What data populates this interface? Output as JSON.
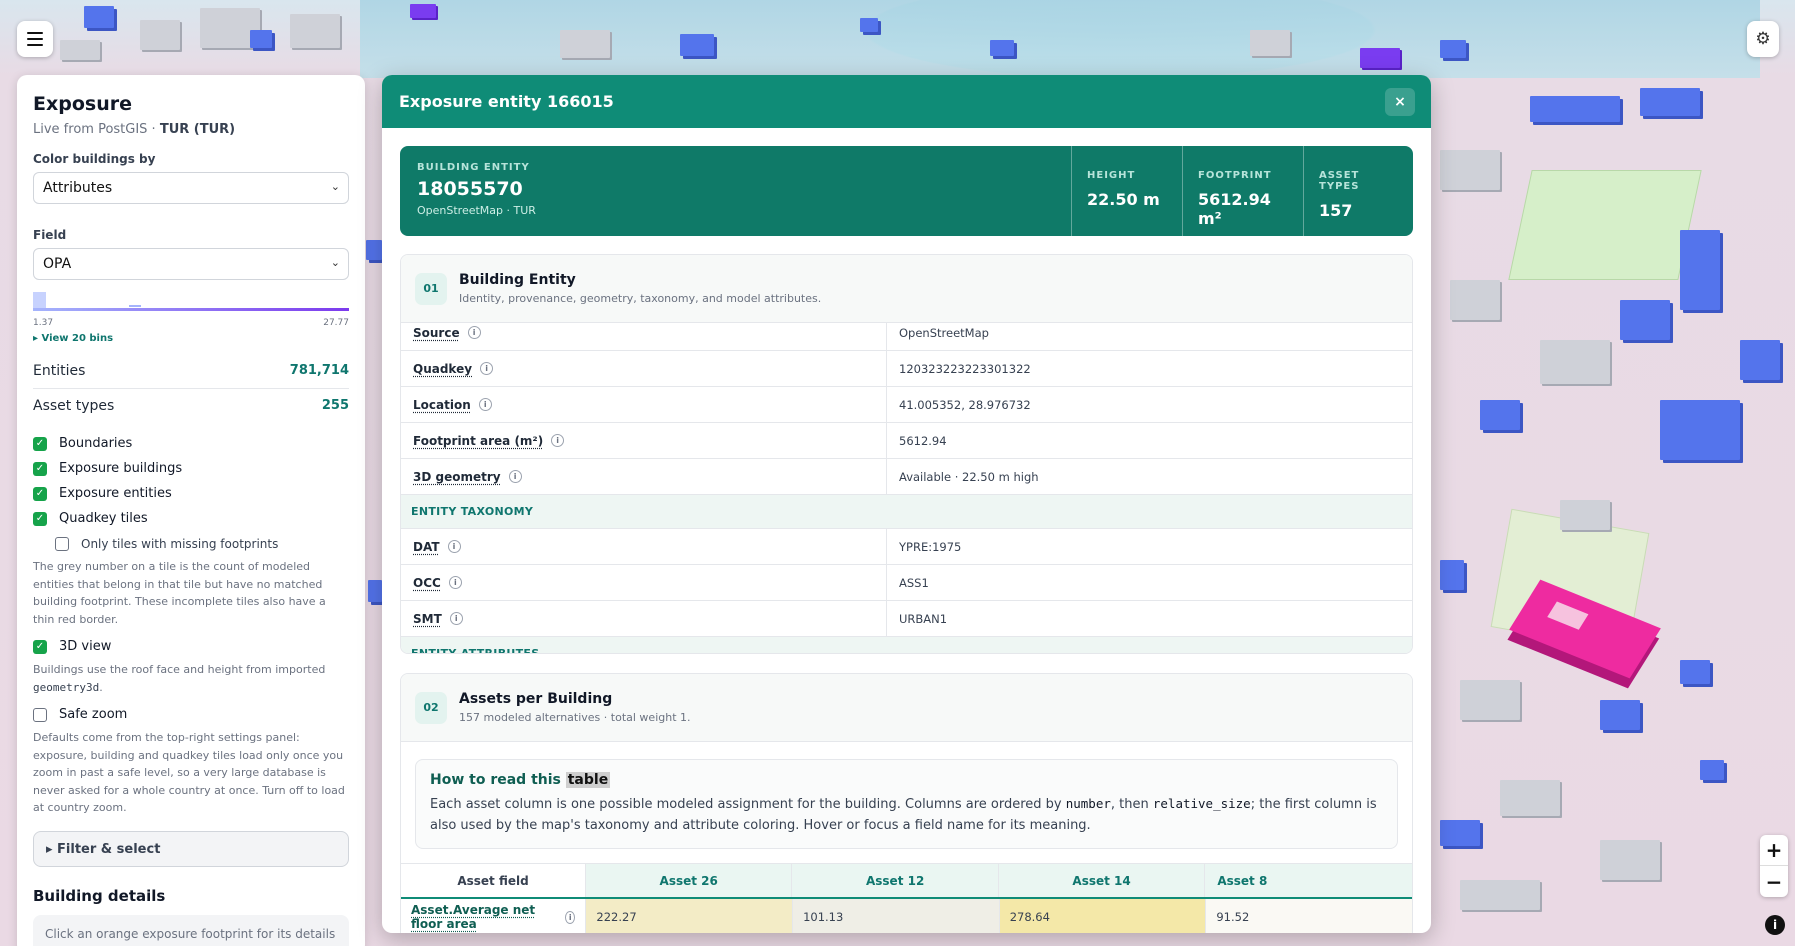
{
  "toolbar": {
    "menu_icon": "hamburger-menu-icon",
    "settings_icon": "gear-icon"
  },
  "sidebar": {
    "title": "Exposure",
    "subtitle_prefix": "Live from PostGIS · ",
    "subtitle_country": "TUR (TUR)",
    "color_by_label": "Color buildings by",
    "color_by_value": "Attributes",
    "field_label": "Field",
    "field_value": "OPA",
    "range_min": "1.37",
    "range_max": "27.77",
    "view_bins": "▸ View 20 bins",
    "stats": [
      {
        "label": "Entities",
        "value": "781,714"
      },
      {
        "label": "Asset types",
        "value": "255"
      }
    ],
    "layers": [
      {
        "label": "Boundaries",
        "checked": true
      },
      {
        "label": "Exposure buildings",
        "checked": true
      },
      {
        "label": "Exposure entities",
        "checked": true
      },
      {
        "label": "Quadkey tiles",
        "checked": true
      }
    ],
    "missing_footprints_label": "Only tiles with missing footprints",
    "missing_help": "The grey number on a tile is the count of modeled entities that belong in that tile but have no matched building footprint. These incomplete tiles also have a thin red border.",
    "view3d_label": "3D view",
    "view3d_help_prefix": "Buildings use the roof face and height from imported ",
    "view3d_help_code": "geometry3d",
    "view3d_help_suffix": ".",
    "safe_zoom_label": "Safe zoom",
    "safe_zoom_help": "Defaults come from the top-right settings panel: exposure, building and quadkey tiles load only once you zoom in past a safe level, so a very large database is never asked for a whole country at once. Turn off to load at country zoom.",
    "filter_label": "▸  Filter & select",
    "building_details_title": "Building details",
    "building_details_hint": "Click an orange exposure footprint for its details"
  },
  "modal": {
    "title": "Exposure entity 166015",
    "close_label": "×",
    "hero": {
      "kicker": "BUILDING ENTITY",
      "id": "18055570",
      "source": "OpenStreetMap · TUR",
      "metrics": [
        {
          "label": "HEIGHT",
          "value": "22.50 m"
        },
        {
          "label": "FOOTPRINT",
          "value": "5612.94 m²"
        },
        {
          "label": "ASSET TYPES",
          "value": "157"
        }
      ]
    },
    "section1": {
      "num": "01",
      "title": "Building Entity",
      "desc": "Identity, provenance, geometry, taxonomy, and model attributes.",
      "rows": [
        {
          "key": "Source",
          "value": "OpenStreetMap"
        },
        {
          "key": "Quadkey",
          "value": "120323223223301322"
        },
        {
          "key": "Location",
          "value": "41.005352, 28.976732"
        },
        {
          "key": "Footprint area (m²)",
          "value": "5612.94"
        },
        {
          "key": "3D geometry",
          "value": "Available · 22.50 m high"
        }
      ],
      "taxonomy_label": "ENTITY TAXONOMY",
      "taxonomy_rows": [
        {
          "key": "DAT",
          "value": "YPRE:1975"
        },
        {
          "key": "OCC",
          "value": "ASS1"
        },
        {
          "key": "SMT",
          "value": "URBAN1"
        }
      ],
      "attributes_label": "ENTITY ATTRIBUTES"
    },
    "section2": {
      "num": "02",
      "title": "Assets per Building",
      "desc": "157 modeled alternatives · total weight 1.",
      "howto_title": "How to read this ",
      "howto_title_hl": "table",
      "howto_p1": "Each asset column is one possible modeled assignment for the building. Columns are ordered by ",
      "howto_c1": "number",
      "howto_p2": ", then ",
      "howto_c2": "relative_size",
      "howto_p3": "; the first column is also used by the map's taxonomy and attribute coloring. Hover or focus a field name for its meaning.",
      "columns": [
        "Asset field",
        "Asset 26",
        "Asset 12",
        "Asset 14",
        "Asset 8"
      ],
      "row_label": "Asset.Average net floor area",
      "row_values": [
        "222.27",
        "101.13",
        "278.64",
        "91.52"
      ],
      "heat_colors": [
        "#f3ecc6",
        "#efeee6",
        "#f4e8a8",
        "#faf9f4"
      ]
    }
  },
  "map": {
    "zoom_in": "+",
    "zoom_out": "−",
    "attribution": "i"
  }
}
